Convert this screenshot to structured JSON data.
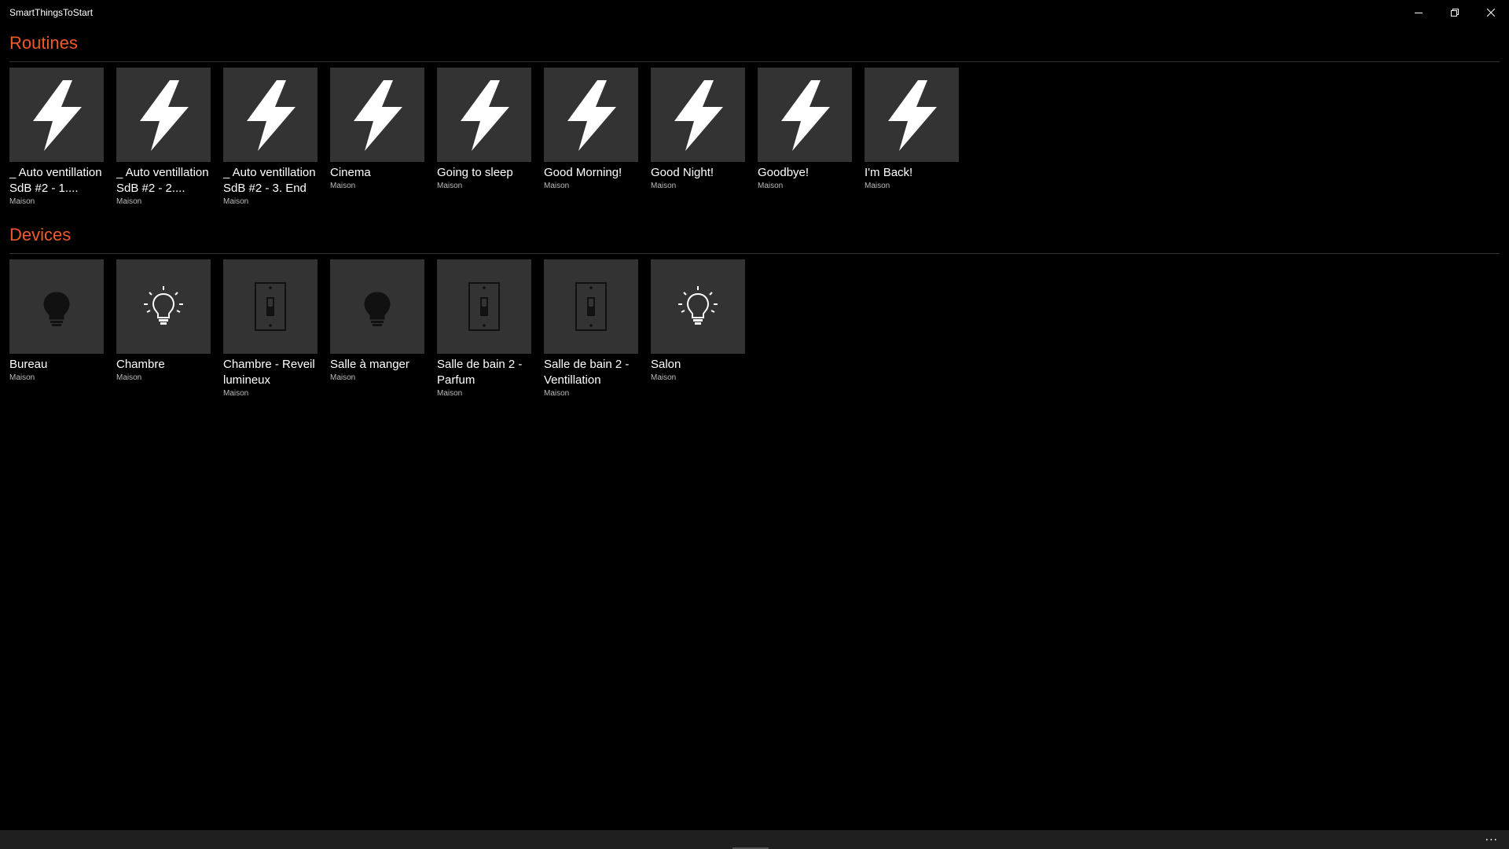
{
  "window": {
    "title": "SmartThingsToStart"
  },
  "theme": {
    "accent": "#f05a28",
    "tile_bg": "#333333",
    "background": "#000000"
  },
  "routines": {
    "title": "Routines",
    "items": [
      {
        "label": "_ Auto ventillation SdB #2 - 1....",
        "sub": "Maison",
        "icon": "lightning-icon"
      },
      {
        "label": "_ Auto ventillation SdB #2 - 2....",
        "sub": "Maison",
        "icon": "lightning-icon"
      },
      {
        "label": "_ Auto ventillation SdB #2 - 3. End",
        "sub": "Maison",
        "icon": "lightning-icon"
      },
      {
        "label": "Cinema",
        "sub": "Maison",
        "icon": "lightning-icon"
      },
      {
        "label": "Going to sleep",
        "sub": "Maison",
        "icon": "lightning-icon"
      },
      {
        "label": "Good Morning!",
        "sub": "Maison",
        "icon": "lightning-icon"
      },
      {
        "label": "Good Night!",
        "sub": "Maison",
        "icon": "lightning-icon"
      },
      {
        "label": "Goodbye!",
        "sub": "Maison",
        "icon": "lightning-icon"
      },
      {
        "label": "I'm Back!",
        "sub": "Maison",
        "icon": "lightning-icon"
      }
    ]
  },
  "devices": {
    "title": "Devices",
    "items": [
      {
        "label": "Bureau",
        "sub": "Maison",
        "icon": "lightbulb-off-icon"
      },
      {
        "label": "Chambre",
        "sub": "Maison",
        "icon": "lightbulb-on-icon"
      },
      {
        "label": "Chambre - Reveil lumineux",
        "sub": "Maison",
        "icon": "switch-icon"
      },
      {
        "label": "Salle à manger",
        "sub": "Maison",
        "icon": "lightbulb-off-icon"
      },
      {
        "label": "Salle de bain 2 - Parfum",
        "sub": "Maison",
        "icon": "switch-icon"
      },
      {
        "label": "Salle de bain 2 - Ventillation",
        "sub": "Maison",
        "icon": "switch-icon"
      },
      {
        "label": "Salon",
        "sub": "Maison",
        "icon": "lightbulb-on-icon"
      }
    ]
  },
  "appbar": {
    "more_label": "..."
  }
}
